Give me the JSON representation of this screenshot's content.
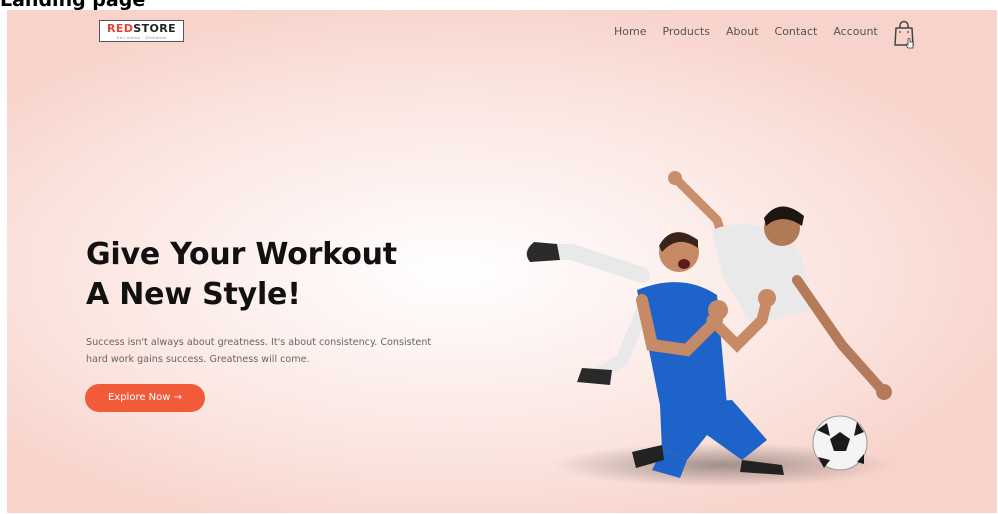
{
  "page_heading": "Landing page",
  "brand": {
    "name_part1": "RED",
    "name_part2": "STORE",
    "tagline": "Sell online · Globalize"
  },
  "nav": {
    "items": [
      "Home",
      "Products",
      "About",
      "Contact",
      "Account"
    ],
    "cart_icon": "shopping-bag-icon"
  },
  "hero": {
    "title_line1": "Give Your Workout",
    "title_line2": "A New Style!",
    "text_line1": "Success isn't always about greatness. It's about consistency. Consistent",
    "text_line2": "hard work gains success. Greatness will come.",
    "cta_label": "Explore Now →"
  },
  "colors": {
    "accent": "#f25b3a",
    "brand_red": "#e2443b",
    "background": "#fbe3dd",
    "jersey_blue": "#1d63c9"
  }
}
